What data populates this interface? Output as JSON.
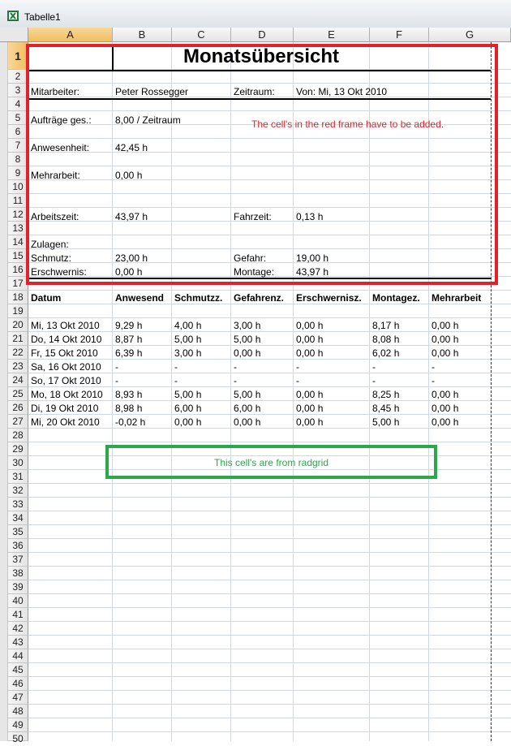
{
  "window": {
    "title": "Tabelle1",
    "icon": "excel-icon"
  },
  "columns": [
    "A",
    "B",
    "C",
    "D",
    "E",
    "F",
    "G"
  ],
  "selected_column": "A",
  "rows": [
    "1",
    "2",
    "3",
    "4",
    "5",
    "6",
    "7",
    "8",
    "9",
    "10",
    "11",
    "12",
    "13",
    "14",
    "15",
    "16",
    "17",
    "18",
    "19",
    "20",
    "21",
    "22",
    "23",
    "24",
    "25",
    "26",
    "27",
    "28",
    "29",
    "30",
    "31",
    "32",
    "33",
    "34",
    "35",
    "36",
    "37",
    "38",
    "39",
    "40",
    "41",
    "42",
    "43",
    "44",
    "45",
    "46",
    "47",
    "48",
    "49",
    "50"
  ],
  "selected_row": "1",
  "report": {
    "title": "Monatsübersicht",
    "employee_label": "Mitarbeiter:",
    "employee_value": "Peter Rossegger",
    "period_label": "Zeitraum:",
    "period_value": "Von: Mi, 13 Okt 2010",
    "orders_label": "Aufträge ges.:",
    "orders_value": "8,00 / Zeitraum",
    "presence_label": "Anwesenheit:",
    "presence_value": "42,45 h",
    "overtime_label": "Mehrarbeit:",
    "overtime_value": "0,00 h",
    "worktime_label": "Arbeitszeit:",
    "worktime_value": "43,97 h",
    "drivetime_label": "Fahrzeit:",
    "drivetime_value": "0,13 h",
    "allowances_label": "Zulagen:",
    "dirt_label": "Schmutz:",
    "dirt_value": "23,00 h",
    "danger_label": "Gefahr:",
    "danger_value": "19,00 h",
    "hardship_label": "Erschwernis:",
    "hardship_value": "0,00 h",
    "assembly_label": "Montage:",
    "assembly_value": "43,97 h"
  },
  "table": {
    "headers": [
      "Datum",
      "Anwesend",
      "Schmutzz.",
      "Gefahrenz.",
      "Erschwernisz.",
      "Montagez.",
      "Mehrarbeit"
    ],
    "rows": [
      [
        "Mi, 13 Okt 2010",
        "9,29 h",
        "4,00 h",
        "3,00 h",
        "0,00 h",
        "8,17 h",
        "0,00 h"
      ],
      [
        "Do, 14 Okt 2010",
        "8,87 h",
        "5,00 h",
        "5,00 h",
        "0,00 h",
        "8,08 h",
        "0,00 h"
      ],
      [
        "Fr, 15 Okt 2010",
        "6,39 h",
        "3,00 h",
        "0,00 h",
        "0,00 h",
        "6,02 h",
        "0,00 h"
      ],
      [
        "Sa, 16 Okt 2010",
        "-",
        "-",
        "-",
        "-",
        "-",
        "-"
      ],
      [
        "So, 17 Okt 2010",
        "-",
        "-",
        "-",
        "-",
        "-",
        "-"
      ],
      [
        "Mo, 18 Okt 2010",
        "8,93 h",
        "5,00 h",
        "5,00 h",
        "0,00 h",
        "8,25 h",
        "0,00 h"
      ],
      [
        "Di, 19 Okt 2010",
        "8,98 h",
        "6,00 h",
        "6,00 h",
        "0,00 h",
        "8,45 h",
        "0,00 h"
      ],
      [
        "Mi, 20 Okt 2010",
        "-0,02 h",
        "0,00 h",
        "0,00 h",
        "0,00 h",
        "5,00 h",
        "0,00 h"
      ]
    ]
  },
  "annotations": {
    "red_note": "The cell's in the red frame have to be added.",
    "green_note": "This cell's are from radgrid",
    "red_color": "#e2222a",
    "green_color": "#2aa84a"
  }
}
